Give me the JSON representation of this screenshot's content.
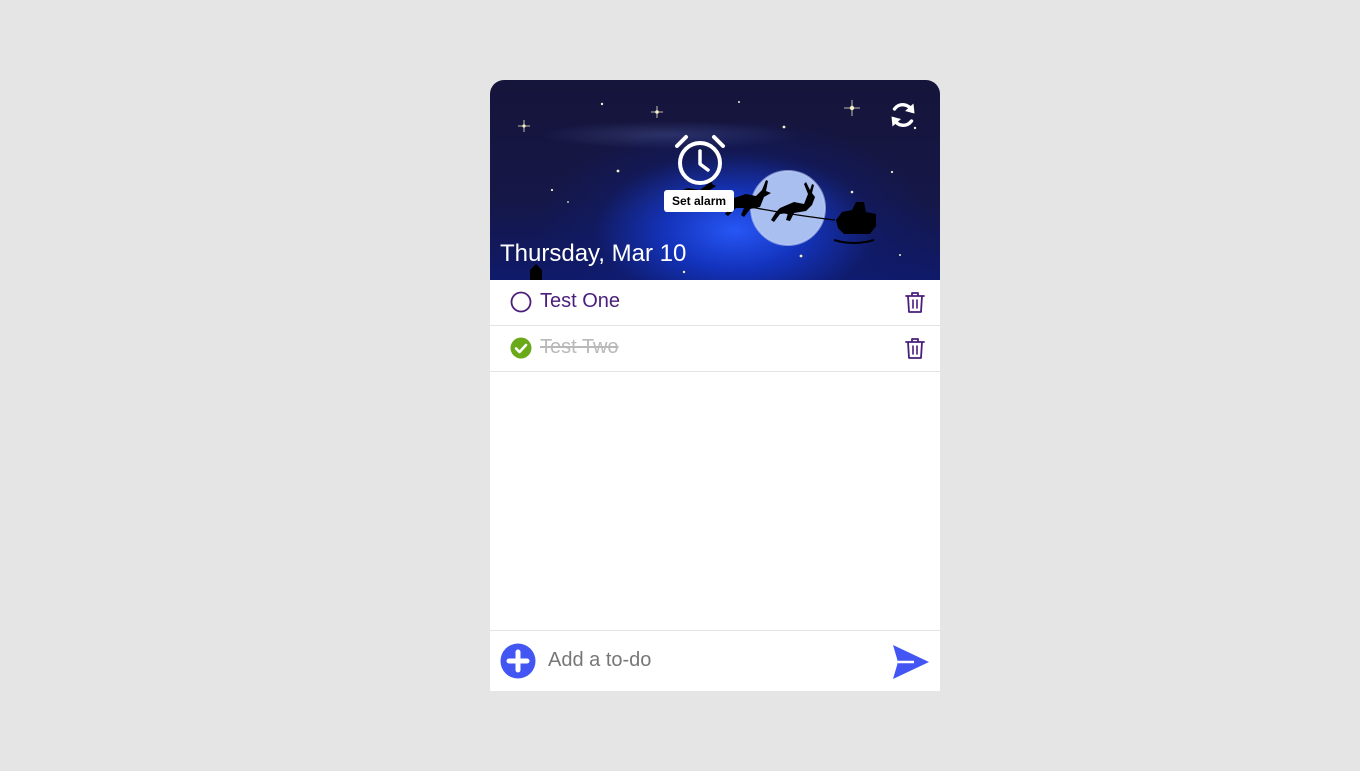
{
  "header": {
    "date": "Thursday, Mar 10",
    "alarm_tooltip": "Set alarm",
    "icons": {
      "refresh": "refresh-icon",
      "alarm": "alarm-clock-icon"
    }
  },
  "todos": [
    {
      "text": "Test One",
      "completed": false
    },
    {
      "text": "Test Two",
      "completed": true
    }
  ],
  "add": {
    "placeholder": "Add a to-do",
    "icons": {
      "add": "plus-circle-icon",
      "send": "send-icon"
    }
  },
  "colors": {
    "accent": "#4355f2",
    "todo_text": "#4a1e7a",
    "done_text": "#b9b9b9",
    "check_done": "#6aaa1a",
    "page_bg": "#e5e5e5"
  }
}
